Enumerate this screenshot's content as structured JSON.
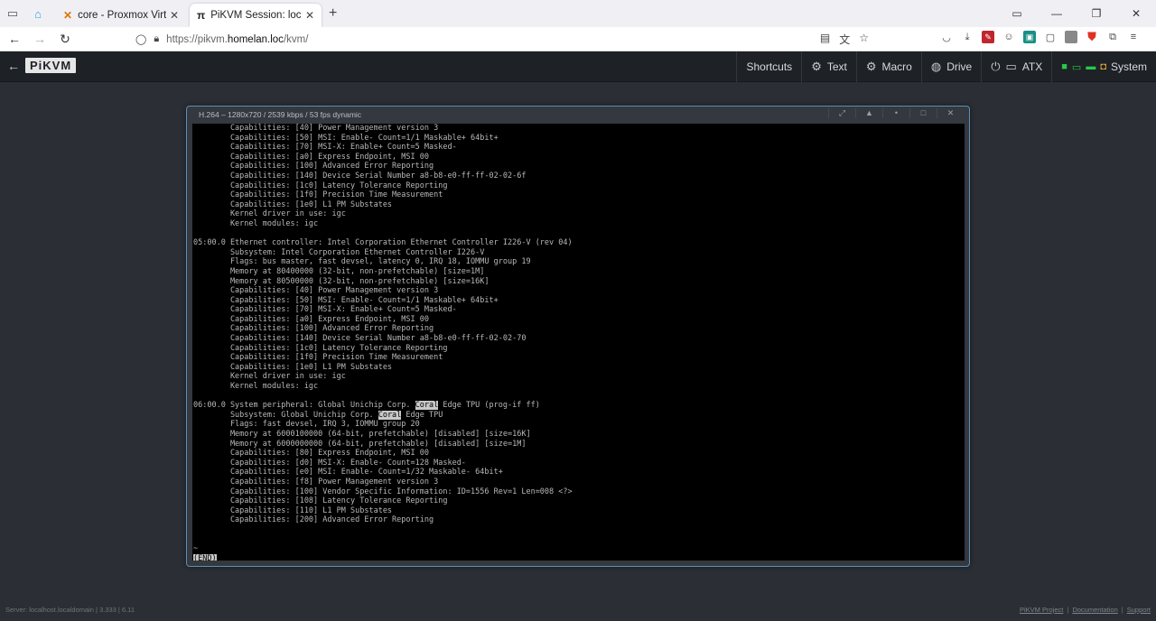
{
  "browser": {
    "tabs": [
      {
        "label": "core - Proxmox Virtual Environment",
        "favicon": "proxmox-icon"
      },
      {
        "label": "PiKVM Session: localhost.localdomain",
        "favicon": "pi-icon"
      }
    ],
    "url": {
      "prefix": "https://pikvm.",
      "host": "homelan.loc",
      "path": "/kvm/"
    }
  },
  "kvm": {
    "logo": "PiKVM",
    "menu": {
      "shortcuts": "Shortcuts",
      "text": "Text",
      "macro": "Macro",
      "drive": "Drive",
      "atx": "ATX",
      "system": "System"
    }
  },
  "stream": {
    "title": "H.264 – 1280x720 / 2539 kbps / 53 fps dynamic"
  },
  "terminal": {
    "lines": [
      {
        "t": "        Capabilities: [40] Power Management version 3"
      },
      {
        "t": "        Capabilities: [50] MSI: Enable- Count=1/1 Maskable+ 64bit+"
      },
      {
        "t": "        Capabilities: [70] MSI-X: Enable+ Count=5 Masked-"
      },
      {
        "t": "        Capabilities: [a0] Express Endpoint, MSI 00"
      },
      {
        "t": "        Capabilities: [100] Advanced Error Reporting"
      },
      {
        "t": "        Capabilities: [140] Device Serial Number a8-b8-e0-ff-ff-02-02-6f"
      },
      {
        "t": "        Capabilities: [1c0] Latency Tolerance Reporting"
      },
      {
        "t": "        Capabilities: [1f0] Precision Time Measurement"
      },
      {
        "t": "        Capabilities: [1e0] L1 PM Substates"
      },
      {
        "t": "        Kernel driver in use: igc"
      },
      {
        "t": "        Kernel modules: igc"
      },
      {
        "t": ""
      },
      {
        "t": "05:00.0 Ethernet controller: Intel Corporation Ethernet Controller I226-V (rev 04)"
      },
      {
        "t": "        Subsystem: Intel Corporation Ethernet Controller I226-V"
      },
      {
        "t": "        Flags: bus master, fast devsel, latency 0, IRQ 18, IOMMU group 19"
      },
      {
        "t": "        Memory at 80400000 (32-bit, non-prefetchable) [size=1M]"
      },
      {
        "t": "        Memory at 80500000 (32-bit, non-prefetchable) [size=16K]"
      },
      {
        "t": "        Capabilities: [40] Power Management version 3"
      },
      {
        "t": "        Capabilities: [50] MSI: Enable- Count=1/1 Maskable+ 64bit+"
      },
      {
        "t": "        Capabilities: [70] MSI-X: Enable+ Count=5 Masked-"
      },
      {
        "t": "        Capabilities: [a0] Express Endpoint, MSI 00"
      },
      {
        "t": "        Capabilities: [100] Advanced Error Reporting"
      },
      {
        "t": "        Capabilities: [140] Device Serial Number a8-b8-e0-ff-ff-02-02-70"
      },
      {
        "t": "        Capabilities: [1c0] Latency Tolerance Reporting"
      },
      {
        "t": "        Capabilities: [1f0] Precision Time Measurement"
      },
      {
        "t": "        Capabilities: [1e0] L1 PM Substates"
      },
      {
        "t": "        Kernel driver in use: igc"
      },
      {
        "t": "        Kernel modules: igc"
      },
      {
        "t": ""
      },
      {
        "t": "06:00.0 System peripheral: Global Unichip Corp. ",
        "hl": "Coral",
        "after": " Edge TPU (prog-if ff)"
      },
      {
        "t": "        Subsystem: Global Unichip Corp. ",
        "hl": "Coral",
        "after": " Edge TPU"
      },
      {
        "t": "        Flags: fast devsel, IRQ 3, IOMMU group 20"
      },
      {
        "t": "        Memory at 6000100000 (64-bit, prefetchable) [disabled] [size=16K]"
      },
      {
        "t": "        Memory at 6000000000 (64-bit, prefetchable) [disabled] [size=1M]"
      },
      {
        "t": "        Capabilities: [80] Express Endpoint, MSI 00"
      },
      {
        "t": "        Capabilities: [d0] MSI-X: Enable- Count=128 Masked-"
      },
      {
        "t": "        Capabilities: [e0] MSI: Enable- Count=1/32 Maskable- 64bit+"
      },
      {
        "t": "        Capabilities: [f8] Power Management version 3"
      },
      {
        "t": "        Capabilities: [100] Vendor Specific Information: ID=1556 Rev=1 Len=008 <?>"
      },
      {
        "t": "        Capabilities: [108] Latency Tolerance Reporting"
      },
      {
        "t": "        Capabilities: [110] L1 PM Substates"
      },
      {
        "t": "        Capabilities: [200] Advanced Error Reporting"
      },
      {
        "t": ""
      },
      {
        "t": ""
      },
      {
        "t": "~"
      }
    ],
    "end_marker": "(END)"
  },
  "footer": {
    "server": "Server: localhost.localdomain | 3.333 | 6.11",
    "links": [
      "PiKVM Project",
      "Documentation",
      "Support"
    ]
  }
}
